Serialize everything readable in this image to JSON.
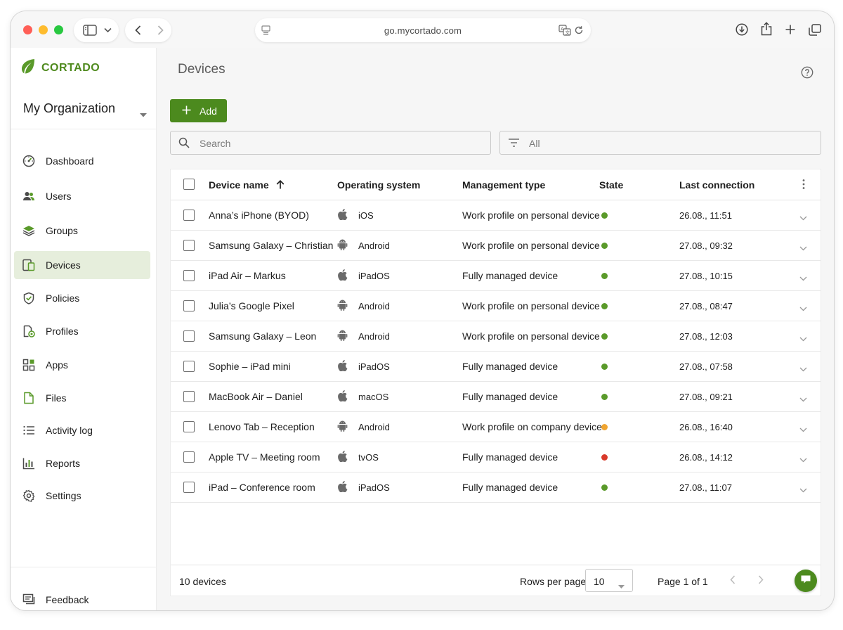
{
  "browser": {
    "url": "go.mycortado.com"
  },
  "brand": {
    "name": "CORTADO",
    "accent": "#4c8a1e",
    "logo_icon": "leaf-icon"
  },
  "sidebar": {
    "org_name": "My Organization",
    "items": [
      {
        "label": "Dashboard",
        "icon": "dashboard-icon"
      },
      {
        "label": "Users",
        "icon": "users-icon"
      },
      {
        "label": "Groups",
        "icon": "groups-icon"
      },
      {
        "label": "Devices",
        "icon": "devices-icon",
        "active": true
      },
      {
        "label": "Policies",
        "icon": "shield-check-icon"
      },
      {
        "label": "Profiles",
        "icon": "profile-doc-icon"
      },
      {
        "label": "Apps",
        "icon": "apps-grid-icon"
      },
      {
        "label": "Files",
        "icon": "file-icon"
      },
      {
        "label": "Activity log",
        "icon": "list-icon"
      },
      {
        "label": "Reports",
        "icon": "bar-chart-icon"
      },
      {
        "label": "Settings",
        "icon": "gear-icon"
      }
    ],
    "feedback_label": "Feedback"
  },
  "main": {
    "title": "Devices",
    "add_label": "Add",
    "search_placeholder": "Search",
    "filter_value": "All"
  },
  "table": {
    "columns": {
      "name": "Device name",
      "os": "Operating system",
      "mgmt": "Management type",
      "state": "State",
      "last": "Last connection"
    },
    "rows": [
      {
        "name": "Anna’s iPhone (BYOD)",
        "os": "iOS",
        "os_icon": "apple-icon",
        "mgmt": "Work profile on personal device",
        "state": "green",
        "last": "26.08., 11:51"
      },
      {
        "name": "Samsung Galaxy – Christian",
        "os": "Android",
        "os_icon": "android-icon",
        "mgmt": "Work profile on personal device",
        "state": "green",
        "last": "27.08., 09:32"
      },
      {
        "name": "iPad Air – Markus",
        "os": "iPadOS",
        "os_icon": "apple-icon",
        "mgmt": "Fully managed device",
        "state": "green",
        "last": "27.08., 10:15"
      },
      {
        "name": "Julia’s Google Pixel",
        "os": "Android",
        "os_icon": "android-icon",
        "mgmt": "Work profile on personal device",
        "state": "green",
        "last": "27.08., 08:47"
      },
      {
        "name": "Samsung Galaxy – Leon",
        "os": "Android",
        "os_icon": "android-icon",
        "mgmt": "Work profile on personal device",
        "state": "green",
        "last": "27.08., 12:03"
      },
      {
        "name": "Sophie – iPad mini",
        "os": "iPadOS",
        "os_icon": "apple-icon",
        "mgmt": "Fully managed device",
        "state": "green",
        "last": "27.08., 07:58"
      },
      {
        "name": "MacBook Air – Daniel",
        "os": "macOS",
        "os_icon": "apple-icon",
        "mgmt": "Fully managed device",
        "state": "green",
        "last": "27.08., 09:21"
      },
      {
        "name": "Lenovo Tab – Reception",
        "os": "Android",
        "os_icon": "android-icon",
        "mgmt": "Work profile on company device",
        "state": "orange",
        "last": "26.08., 16:40"
      },
      {
        "name": "Apple TV – Meeting room",
        "os": "tvOS",
        "os_icon": "apple-icon",
        "mgmt": "Fully managed device",
        "state": "red",
        "last": "26.08., 14:12"
      },
      {
        "name": "iPad – Conference room",
        "os": "iPadOS",
        "os_icon": "apple-icon",
        "mgmt": "Fully managed device",
        "state": "green",
        "last": "27.08., 11:07"
      }
    ],
    "state_colors": {
      "green": "#5a9a2a",
      "orange": "#f0a531",
      "red": "#d93a2b"
    }
  },
  "footer": {
    "count": "10 devices",
    "rows_label": "Rows per page",
    "rows_value": "10",
    "page_info": "Page 1 of 1"
  }
}
